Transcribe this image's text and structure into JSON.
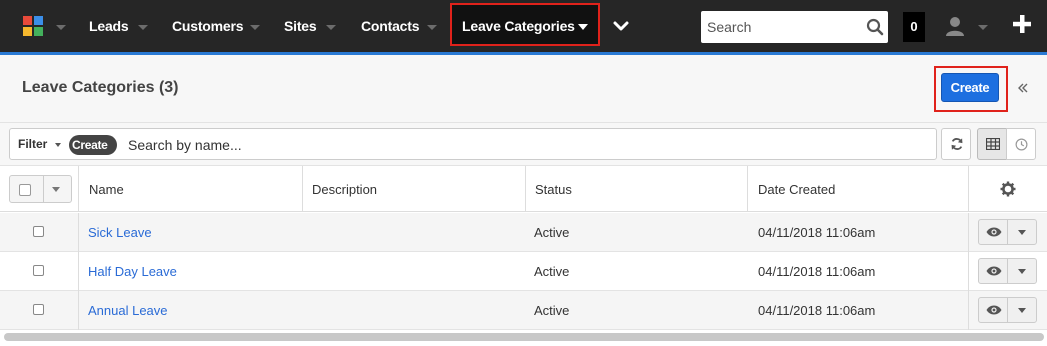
{
  "nav": {
    "items": [
      {
        "label": "Leads"
      },
      {
        "label": "Customers"
      },
      {
        "label": "Sites"
      },
      {
        "label": "Contacts"
      }
    ],
    "active_label": "Leave Categories",
    "search_placeholder": "Search",
    "notification_count": "0",
    "colors": {
      "bar": "#262626",
      "accent": "#2a7ad4",
      "highlight": "#e0221b"
    }
  },
  "header": {
    "title": "Leave Categories (3)",
    "create_label": "Create"
  },
  "filter": {
    "filter_label": "Filter",
    "create_tag": "Create",
    "search_placeholder": "Search by name..."
  },
  "table": {
    "columns": [
      "Name",
      "Description",
      "Status",
      "Date Created"
    ],
    "rows": [
      {
        "name": "Sick Leave",
        "description": "",
        "status": "Active",
        "date_created": "04/11/2018 11:06am"
      },
      {
        "name": "Half Day Leave",
        "description": "",
        "status": "Active",
        "date_created": "04/11/2018 11:06am"
      },
      {
        "name": "Annual Leave",
        "description": "",
        "status": "Active",
        "date_created": "04/11/2018 11:06am"
      }
    ]
  },
  "icons": [
    "app-logo-icon",
    "chevron-down-icon",
    "search-icon",
    "user-icon",
    "plus-icon",
    "collapse-icon",
    "refresh-icon",
    "grid-icon",
    "clock-icon",
    "gear-icon",
    "eye-icon"
  ]
}
